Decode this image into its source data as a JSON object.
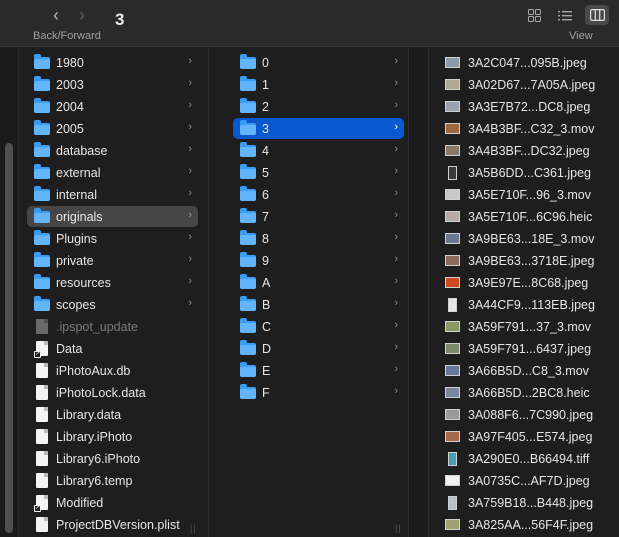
{
  "toolbar": {
    "title": "3",
    "back_icon": "chevron-left-icon",
    "forward_icon": "chevron-right-icon",
    "nav_label": "Back/Forward",
    "view_label": "View",
    "view_modes": [
      "icon-grid-icon",
      "list-view-icon",
      "column-view-icon"
    ],
    "active_view": "column-view-icon"
  },
  "columns": [
    {
      "items": [
        {
          "name": "1980",
          "kind": "folder",
          "chevron": "›"
        },
        {
          "name": "2003",
          "kind": "folder",
          "chevron": "›"
        },
        {
          "name": "2004",
          "kind": "folder",
          "chevron": "›"
        },
        {
          "name": "2005",
          "kind": "folder",
          "chevron": "›"
        },
        {
          "name": "database",
          "kind": "folder",
          "chevron": "›"
        },
        {
          "name": "external",
          "kind": "folder",
          "chevron": "›"
        },
        {
          "name": "internal",
          "kind": "folder",
          "chevron": "›"
        },
        {
          "name": "originals",
          "kind": "folder",
          "chevron": "›",
          "state": "selected-inactive"
        },
        {
          "name": "Plugins",
          "kind": "folder",
          "chevron": "›"
        },
        {
          "name": "private",
          "kind": "folder",
          "chevron": "›"
        },
        {
          "name": "resources",
          "kind": "folder",
          "chevron": "›"
        },
        {
          "name": "scopes",
          "kind": "folder",
          "chevron": "›"
        },
        {
          "name": ".ipspot_update",
          "kind": "file",
          "state": "hidden"
        },
        {
          "name": "Data",
          "kind": "alias"
        },
        {
          "name": "iPhotoAux.db",
          "kind": "file"
        },
        {
          "name": "iPhotoLock.data",
          "kind": "file"
        },
        {
          "name": "Library.data",
          "kind": "file"
        },
        {
          "name": "Library.iPhoto",
          "kind": "file"
        },
        {
          "name": "Library6.iPhoto",
          "kind": "file"
        },
        {
          "name": "Library6.temp",
          "kind": "file"
        },
        {
          "name": "Modified",
          "kind": "alias"
        },
        {
          "name": "ProjectDBVersion.plist",
          "kind": "file"
        }
      ]
    },
    {
      "items": [
        {
          "name": "0",
          "kind": "folder",
          "chevron": "›"
        },
        {
          "name": "1",
          "kind": "folder",
          "chevron": "›"
        },
        {
          "name": "2",
          "kind": "folder",
          "chevron": "›"
        },
        {
          "name": "3",
          "kind": "folder",
          "chevron": "›",
          "state": "selected-active"
        },
        {
          "name": "4",
          "kind": "folder",
          "chevron": "›"
        },
        {
          "name": "5",
          "kind": "folder",
          "chevron": "›"
        },
        {
          "name": "6",
          "kind": "folder",
          "chevron": "›"
        },
        {
          "name": "7",
          "kind": "folder",
          "chevron": "›"
        },
        {
          "name": "8",
          "kind": "folder",
          "chevron": "›"
        },
        {
          "name": "9",
          "kind": "folder",
          "chevron": "›"
        },
        {
          "name": "A",
          "kind": "folder",
          "chevron": "›"
        },
        {
          "name": "B",
          "kind": "folder",
          "chevron": "›"
        },
        {
          "name": "C",
          "kind": "folder",
          "chevron": "›"
        },
        {
          "name": "D",
          "kind": "folder",
          "chevron": "›"
        },
        {
          "name": "E",
          "kind": "folder",
          "chevron": "›"
        },
        {
          "name": "F",
          "kind": "folder",
          "chevron": "›"
        }
      ]
    },
    {
      "items": [
        {
          "name": "3A2C047...095B.jpeg",
          "kind": "image",
          "tint": "#8a9aa8"
        },
        {
          "name": "3A02D67...7A05A.jpeg",
          "kind": "image",
          "tint": "#b0a890"
        },
        {
          "name": "3A3E7B72...DC8.jpeg",
          "kind": "image",
          "tint": "#9aa4b0"
        },
        {
          "name": "3A4B3BF...C32_3.mov",
          "kind": "image",
          "tint": "#a0683a"
        },
        {
          "name": "3A4B3BF...DC32.jpeg",
          "kind": "image",
          "tint": "#8a7868"
        },
        {
          "name": "3A5B6DD...C361.jpeg",
          "kind": "image",
          "tint": "#3a3a3a",
          "portrait": true
        },
        {
          "name": "3A5E710F...96_3.mov",
          "kind": "image",
          "tint": "#c8c8c8"
        },
        {
          "name": "3A5E710F...6C96.heic",
          "kind": "image",
          "tint": "#b8a8a8"
        },
        {
          "name": "3A9BE63...18E_3.mov",
          "kind": "image",
          "tint": "#6a7890"
        },
        {
          "name": "3A9BE63...3718E.jpeg",
          "kind": "image",
          "tint": "#8a6a58"
        },
        {
          "name": "3A9E97E...8C68.jpeg",
          "kind": "image",
          "tint": "#d04a20"
        },
        {
          "name": "3A44CF9...113EB.jpeg",
          "kind": "image",
          "tint": "#e8e8e8",
          "portrait": true
        },
        {
          "name": "3A59F791...37_3.mov",
          "kind": "image",
          "tint": "#8a9868"
        },
        {
          "name": "3A59F791...6437.jpeg",
          "kind": "image",
          "tint": "#7a8a68"
        },
        {
          "name": "3A66B5D...C8_3.mov",
          "kind": "image",
          "tint": "#687898"
        },
        {
          "name": "3A66B5D...2BC8.heic",
          "kind": "image",
          "tint": "#7888a0"
        },
        {
          "name": "3A088F6...7C990.jpeg",
          "kind": "image",
          "tint": "#9a9a9a"
        },
        {
          "name": "3A97F405...E574.jpeg",
          "kind": "image",
          "tint": "#a86848"
        },
        {
          "name": "3A290E0...B66494.tiff",
          "kind": "image",
          "tint": "#48a0b8",
          "portrait": true
        },
        {
          "name": "3A0735C...AF7D.jpeg",
          "kind": "image",
          "tint": "#f0f0f0"
        },
        {
          "name": "3A759B18...B448.jpeg",
          "kind": "image",
          "tint": "#b8c0c8",
          "portrait": true
        },
        {
          "name": "3A825AA...56F4F.jpeg",
          "kind": "image",
          "tint": "#a0a070"
        }
      ]
    }
  ]
}
